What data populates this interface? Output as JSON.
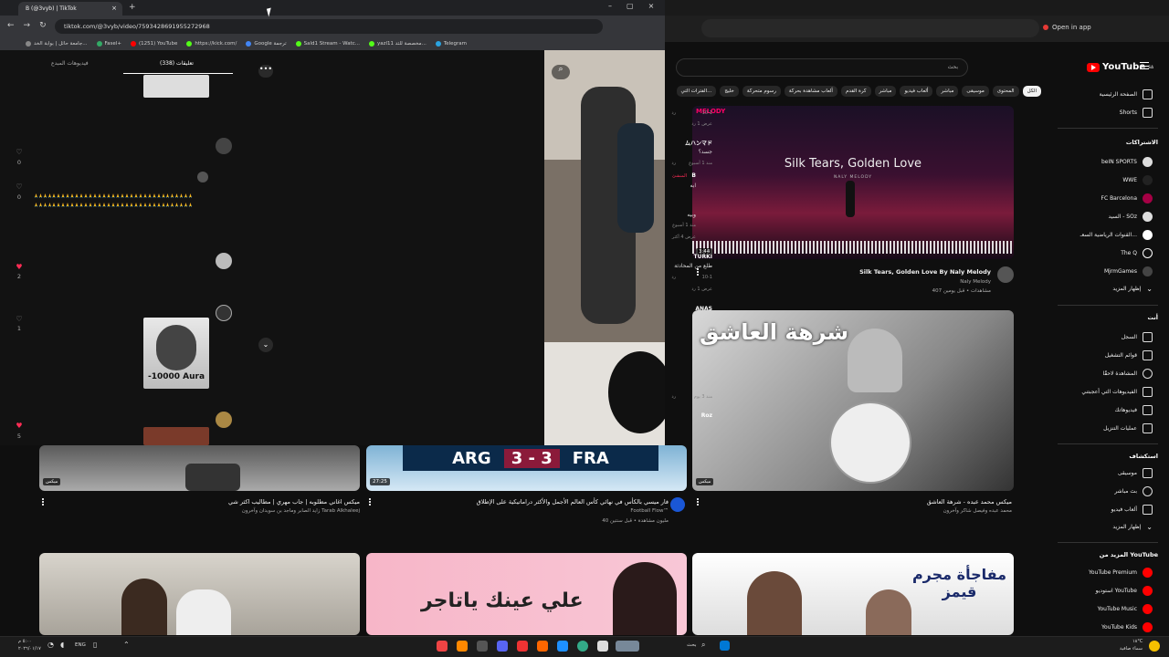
{
  "tiktok_window": {
    "tab_title": "B (@3vyb) | TikTok",
    "url": "tiktok.com/@3vyb/video/7593428691955272968",
    "bookmarks": [
      "جامعة حائل | بوابة الخد...",
      "Fasel+",
      "(1251) YouTube",
      "https://kick.com/",
      "Google ترجمة",
      "Sald1 Stream - Watc...",
      "yazl11 مخصصة للتد...",
      "Telegram"
    ],
    "panel_tabs": {
      "creator_videos": "فيديوهات المبدع",
      "comments": "تعليقات (338)"
    },
    "comments": [
      {
        "meta": "10-1",
        "reply": "رد",
        "view_replies": "عرض 1 رد"
      },
      {
        "name": "ムハンマド",
        "text": "جسد؟",
        "meta": "منذ 1 أسبوع",
        "reply": "رد",
        "likes": "0"
      },
      {
        "name": "B",
        "badge": "المنشئ",
        "text": "ابه",
        "likes": "0"
      },
      {
        "text": "🙏🙏🙏🙏🙏🙏🙏🙏🙏🙏🙏🙏🙏🙏🙏🙏🙏🙏🙏🙏🙏🙏🙏🙏🙏🙏🙏🙏🙏🙏🙏🙏🙏🙏🙏",
        "text2": "🙏🙏🙏🙏🙏🙏🙏🙏🙏🙏🙏🙏🙏🙏🙏🙏🙏🙏🙏🙏🙏🙏🙏🙏🙏🙏🙏🙏🙏🙏🙏🙏🙏🙏🙏",
        "text3": "وبيه",
        "meta": "منذ 1 أسبوع",
        "reply": "رد",
        "view_replies": "عرض 4 أكثر"
      },
      {
        "name": "TURKI",
        "text": "طلع من المحادثة",
        "meta": "10-1",
        "reply": "رد",
        "likes": "2",
        "view_replies": "عرض 1 رد"
      },
      {
        "name": "ANAS",
        "image_text": "-10000 Aura",
        "meta": "منذ 3 يوم",
        "reply": "رد",
        "likes": "1"
      },
      {
        "name": "Roz",
        "likes": "5"
      }
    ]
  },
  "youtube": {
    "open_in_app": "Open in app",
    "logo": "YouTube",
    "logo_sup": "SA",
    "search_placeholder": "بحث",
    "chips": [
      "الكل",
      "المحتوى",
      "موسيقى",
      "مباشر",
      "ألعاب فيديو",
      "مباشر",
      "كرة القدم",
      "ألعاب مشاهدة بحركة",
      "رسوم متحركة",
      "خليج",
      "الفترات التي..."
    ],
    "sidebar": {
      "home": "الصفحة الرئيسية",
      "shorts": "Shorts",
      "subs_header": "الاشتراكات",
      "subs": [
        "beIN SPORTS",
        "WWE",
        "FC Barcelona",
        "السيد - SOz",
        "القنوات الرياضية السعـ...",
        "The Q",
        "MjrmGames",
        "إظهار المزيد"
      ],
      "you_header": "أنت",
      "you": [
        "السجل",
        "قوائم التشغيل",
        "المشاهدة لاحقًا",
        "الفيديوهات التي أعجبتني",
        "فيديوهاتك",
        "عمليات التنزيل"
      ],
      "explore_header": "استكشاف",
      "explore": [
        "موسيقى",
        "بث مباشر",
        "ألعاب فيديو",
        "إظهار المزيد"
      ],
      "more_header": "المزيد من YouTube",
      "more": [
        "YouTube Premium",
        "استوديو YouTube",
        "YouTube Music",
        "YouTube Kids"
      ]
    },
    "videos": [
      {
        "title": "Silk Tears, Golden Love By Naly Melody",
        "channel": "Naly Melody",
        "meta": "407 مشاهدات • قبل يومين",
        "thumb_text": "Silk Tears, Golden Love",
        "thumb_sub": "NALY MELODY",
        "badge": "MELODY",
        "duration": "3:44"
      },
      {
        "title": "ميكس محمد عبده - شرهة العاشق",
        "channel": "محمد عبده وفيصل شاكر وآخرون",
        "thumb_text": "شرهة العاشق",
        "badge": "ميكس"
      },
      {
        "title": "ميكس اغاني مطلوبه | جاب مهري | مطاليب اكثر شي",
        "channel": "زايد الصابر وماجد بن سويدان وآخرون Tarab Alkhaleej",
        "badge": "ميكس"
      },
      {
        "title": "فار ميسي بالكأس في نهائي كأس العالم الأجمل والأكثر دراماتيكية على الإطلاق",
        "channel": "Football Flow™",
        "meta": "40 مليون مشاهدة • قبل سنتين",
        "duration": "27:25",
        "score_left": "ARG",
        "score": "3 - 3",
        "score_right": "FRA"
      },
      {
        "thumb_text": "علي عينك ياتاجر"
      },
      {
        "thumb_text": "مفاجأة مجرم قيمز"
      }
    ]
  },
  "taskbar": {
    "search": "بحث",
    "lang": "ENG",
    "time": "٥:٠٠ م",
    "date": "٢٠٢٦/٠١/١٧",
    "weather": "١٨°C",
    "weather_desc": "سماء صافية"
  },
  "colors": {
    "youtube_red": "#ff0000",
    "tiktok_pink": "#fe2c55"
  }
}
